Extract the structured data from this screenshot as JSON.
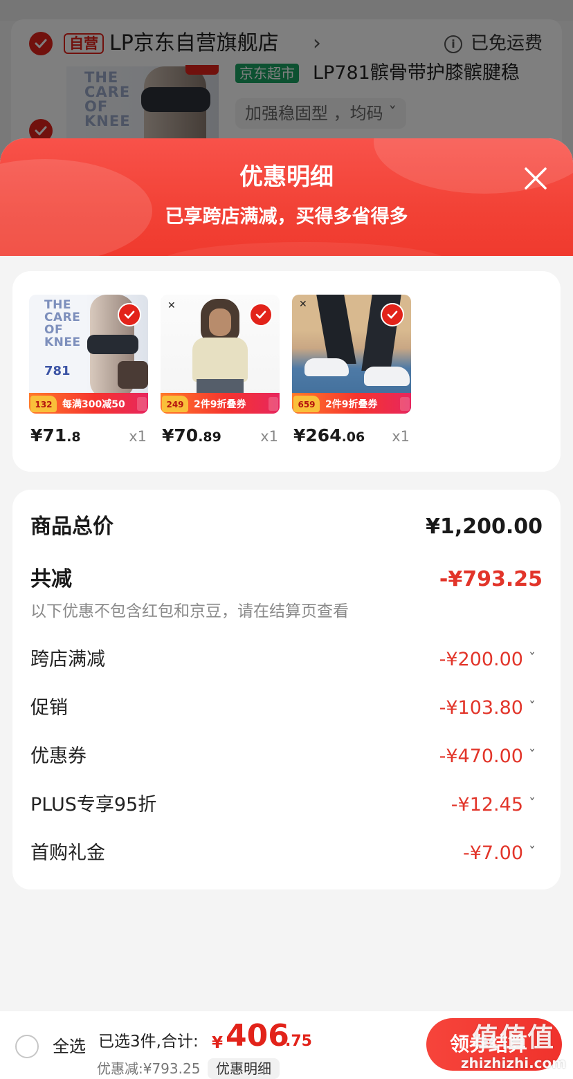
{
  "background_cart": {
    "store_badge": "自营",
    "store_name": "LP京东自营旗舰店",
    "store_chevron": "›",
    "info_icon": "i",
    "shipping_status": "已免运费",
    "product_image_text": "THE\nCARE\nOF\nKNEE",
    "supermarket_tag": "京东超市",
    "product_title": "LP781髌骨带护膝髌腱稳",
    "spec_selector": "加强稳固型 ，均码 ˇ"
  },
  "sheet": {
    "title": "优惠明细",
    "subtitle": "已享跨店满减，买得多省得多",
    "close_icon": "close-icon"
  },
  "products": [
    {
      "image_text": "THE\nCARE\nOF\nKNEE",
      "image_number": "781",
      "promo_price": "132",
      "promo_text": "每满300减50",
      "price_symbol": "¥",
      "price_int": "71",
      "price_dec": ".8",
      "qty": "x1"
    },
    {
      "promo_price": "249",
      "promo_text": "2件9折叠券",
      "price_symbol": "¥",
      "price_int": "70",
      "price_dec": ".89",
      "qty": "x1"
    },
    {
      "promo_price": "659",
      "promo_text": "2件9折叠券",
      "price_symbol": "¥",
      "price_int": "264",
      "price_dec": ".06",
      "qty": "x1"
    }
  ],
  "breakdown": {
    "total_label": "商品总价",
    "total_value": "¥1,200.00",
    "reduce_label": "共减",
    "reduce_value": "-¥793.25",
    "note": "以下优惠不包含红包和京豆，请在结算页查看",
    "items": [
      {
        "label": "跨店满减",
        "value": "-¥200.00"
      },
      {
        "label": "促销",
        "value": "-¥103.80"
      },
      {
        "label": "优惠券",
        "value": "-¥470.00"
      },
      {
        "label": "PLUS专享95折",
        "value": "-¥12.45"
      },
      {
        "label": "首购礼金",
        "value": "-¥7.00"
      }
    ],
    "chevron": "ˇ"
  },
  "bottom_bar": {
    "select_all": "全选",
    "summary": "已选3件,合计:",
    "currency": "¥",
    "total_int": "406",
    "total_dec": ".75",
    "discount_line": "优惠减:¥793.25",
    "detail_chip": "优惠明细",
    "checkout_label": "领券结算"
  },
  "watermark": {
    "title": "值值值",
    "url": "zhizhizhi.com"
  },
  "colors": {
    "accent_red": "#e2231a",
    "price_red": "#e2352a",
    "supermarket_green": "#1aa363"
  }
}
